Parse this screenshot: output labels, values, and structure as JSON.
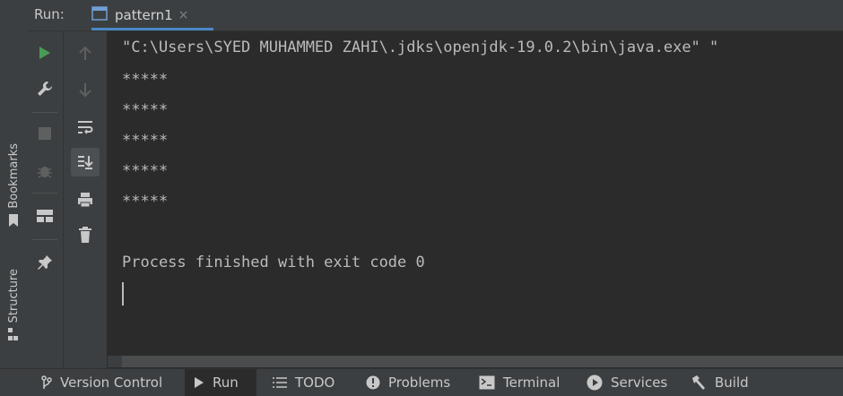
{
  "run_header": {
    "label": "Run:",
    "tab_name": "pattern1",
    "tab_close": "×"
  },
  "left_stripe": {
    "bookmarks": "Bookmarks",
    "structure": "Structure"
  },
  "toolbar": {
    "icons": [
      "rerun-icon",
      "wrench-icon",
      "stop-icon",
      "debug-icon",
      "layout-icon",
      "pin-icon"
    ],
    "icons2": [
      "up-arrow-icon",
      "down-arrow-icon",
      "soft-wrap-icon",
      "scroll-to-end-icon",
      "print-icon",
      "trash-icon"
    ]
  },
  "console": {
    "command": "\"C:\\Users\\SYED MUHAMMED ZAHI\\.jdks\\openjdk-19.0.2\\bin\\java.exe\" \"",
    "lines": [
      "*****",
      "*****",
      "*****",
      "*****",
      "*****"
    ],
    "exit_message": "Process finished with exit code 0"
  },
  "bottom_bar": {
    "items": [
      {
        "label": "Version Control",
        "icon": "branch-icon"
      },
      {
        "label": "Run",
        "icon": "run-icon"
      },
      {
        "label": "TODO",
        "icon": "list-icon"
      },
      {
        "label": "Problems",
        "icon": "alert-icon"
      },
      {
        "label": "Terminal",
        "icon": "terminal-icon"
      },
      {
        "label": "Services",
        "icon": "services-icon"
      },
      {
        "label": "Build",
        "icon": "hammer-icon"
      }
    ]
  },
  "colors": {
    "accent": "#4a88c7",
    "run_green": "#499c54",
    "background": "#2b2b2b",
    "panel": "#3c3f41"
  }
}
